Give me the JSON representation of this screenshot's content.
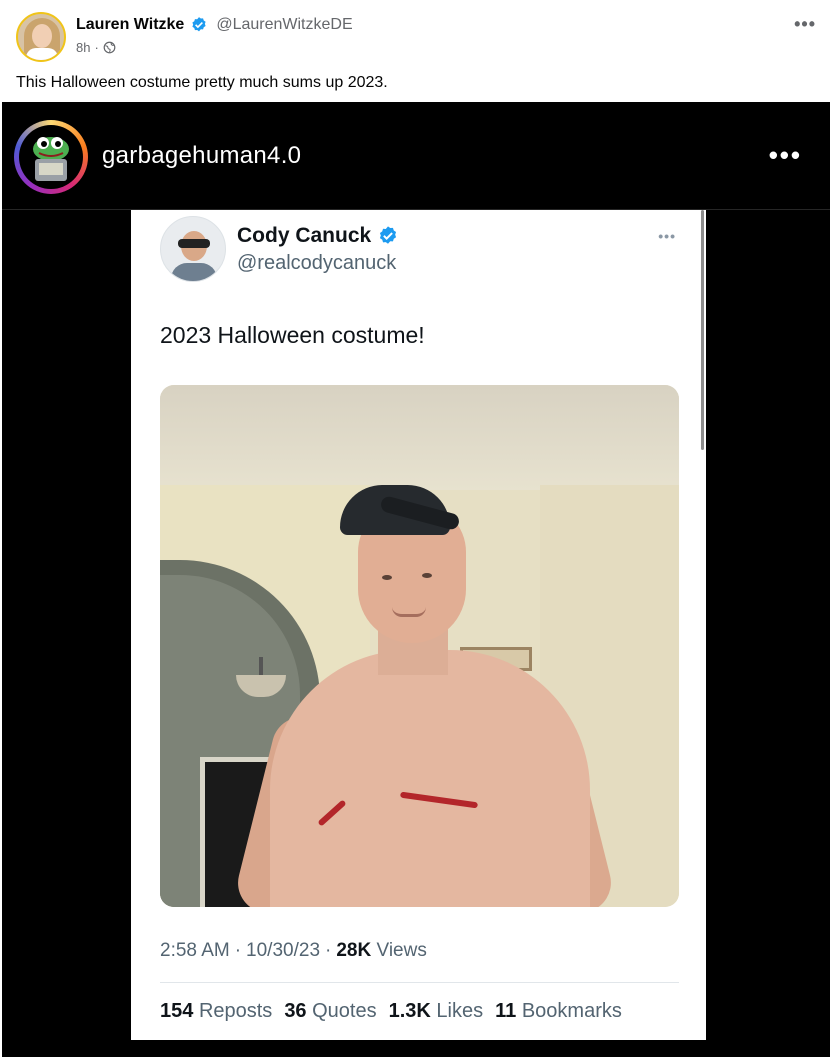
{
  "post": {
    "author_name": "Lauren Witzke",
    "author_handle": "@LaurenWitzkeDE",
    "time": "8h",
    "separator": "·",
    "text": "This Halloween costume pretty much sums up 2023.",
    "more_label": "•••",
    "colors": {
      "verified": "#1d9bf0",
      "muted": "#65676b"
    }
  },
  "instagram": {
    "username": "garbagehuman4.0",
    "more_label": "•••"
  },
  "tweet": {
    "name": "Cody Canuck",
    "handle": "@realcodycanuck",
    "more_label": "•••",
    "text": "2023 Halloween costume!",
    "time": "2:58 AM",
    "date": "10/30/23",
    "views_count": "28K",
    "views_label": "Views",
    "dot": "·",
    "stats": [
      {
        "count": "154",
        "label": "Reposts"
      },
      {
        "count": "36",
        "label": "Quotes"
      },
      {
        "count": "1.3K",
        "label": "Likes"
      },
      {
        "count": "11",
        "label": "Bookmarks"
      }
    ]
  }
}
